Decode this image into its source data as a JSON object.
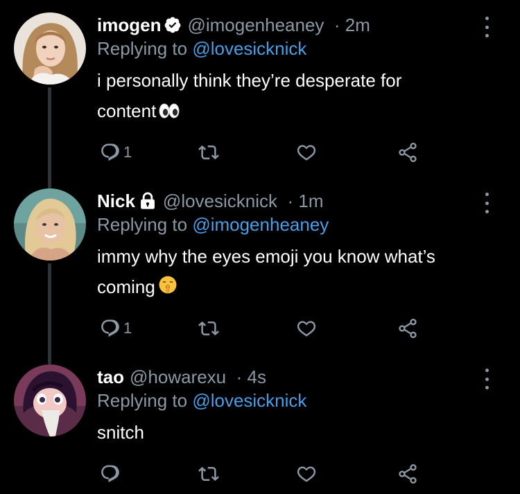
{
  "tweets": [
    {
      "display_name": "imogen",
      "badge": "verified-icon",
      "handle": "@imogenheaney",
      "time": "2m",
      "replying_prefix": "Replying to",
      "replying_to": "@lovesicknick",
      "text_line1": "i personally think they’re desperate for",
      "text_line2": "content",
      "emoji": "eyes-emoji",
      "reply_count": "1"
    },
    {
      "display_name": "Nick",
      "badge": "lock-icon",
      "handle": "@lovesicknick",
      "time": "1m",
      "replying_prefix": "Replying to",
      "replying_to": "@imogenheaney",
      "text_line1": "immy why the eyes emoji you know what’s",
      "text_line2": "coming",
      "emoji": "shushing-face-emoji",
      "reply_count": "1"
    },
    {
      "display_name": "tao",
      "handle": "@howarexu",
      "time": "4s",
      "replying_prefix": "Replying to",
      "replying_to": "@lovesicknick",
      "text_line1": "snitch",
      "reply_count": ""
    }
  ],
  "colors": {
    "background": "#000000",
    "text": "#ffffff",
    "secondary": "#8b98a5",
    "link": "#4a9ee8",
    "thread_line": "#2f3336"
  }
}
